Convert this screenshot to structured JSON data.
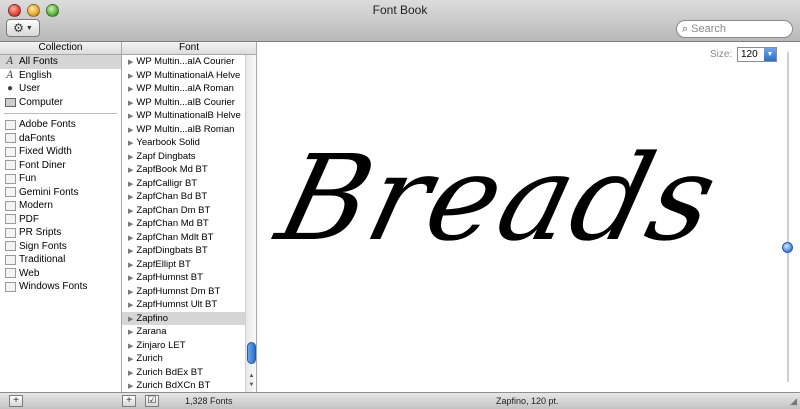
{
  "window": {
    "title": "Font Book"
  },
  "toolbar": {
    "action_icon": "gear-icon",
    "search_placeholder": "Search"
  },
  "collection": {
    "header": "Collection",
    "items": [
      {
        "label": "All Fonts",
        "icon": "font-icon",
        "selected": true
      },
      {
        "label": "English",
        "icon": "font-icon"
      },
      {
        "label": "User",
        "icon": "user-icon"
      },
      {
        "label": "Computer",
        "icon": "computer-icon"
      }
    ],
    "user_items": [
      {
        "label": "Adobe Fonts",
        "icon": "collection-icon"
      },
      {
        "label": "daFonts",
        "icon": "collection-icon"
      },
      {
        "label": "Fixed Width",
        "icon": "collection-icon"
      },
      {
        "label": "Font Diner",
        "icon": "collection-icon"
      },
      {
        "label": "Fun",
        "icon": "collection-icon"
      },
      {
        "label": "Gemini Fonts",
        "icon": "collection-icon"
      },
      {
        "label": "Modern",
        "icon": "collection-icon"
      },
      {
        "label": "PDF",
        "icon": "collection-icon"
      },
      {
        "label": "PR Sripts",
        "icon": "collection-icon"
      },
      {
        "label": "Sign Fonts",
        "icon": "collection-icon"
      },
      {
        "label": "Traditional",
        "icon": "collection-icon"
      },
      {
        "label": "Web",
        "icon": "collection-icon"
      },
      {
        "label": "Windows Fonts",
        "icon": "collection-icon"
      }
    ]
  },
  "fonts": {
    "header": "Font",
    "items": [
      "WP Multin...alA Courier",
      "WP MultinationalA Helve",
      "WP Multin...alA Roman",
      "WP Multin...alB Courier",
      "WP MultinationalB Helve",
      "WP Multin...alB Roman",
      "Yearbook Solid",
      "Zapf Dingbats",
      "ZapfBook Md BT",
      "ZapfCalligr BT",
      "ZapfChan Bd BT",
      "ZapfChan Dm BT",
      "ZapfChan Md BT",
      "ZapfChan Mdlt BT",
      "ZapfDingbats BT",
      "ZapfEllipt BT",
      "ZapfHumnst BT",
      "ZapfHumnst Dm BT",
      "ZapfHumnst Ult BT",
      "Zapfino",
      "Zarana",
      "Zinjaro LET",
      "Zurich",
      "Zurich BdEx BT",
      "Zurich BdXCn BT"
    ],
    "selected": "Zapfino",
    "count_text": "1,328 Fonts"
  },
  "preview": {
    "size_label": "Size:",
    "size_value": "120",
    "sample_text": "Breads",
    "status_text": "Zapfino, 120 pt."
  },
  "bottom": {
    "add_label": "+",
    "add_font_label": "+",
    "check_label": "☑"
  }
}
